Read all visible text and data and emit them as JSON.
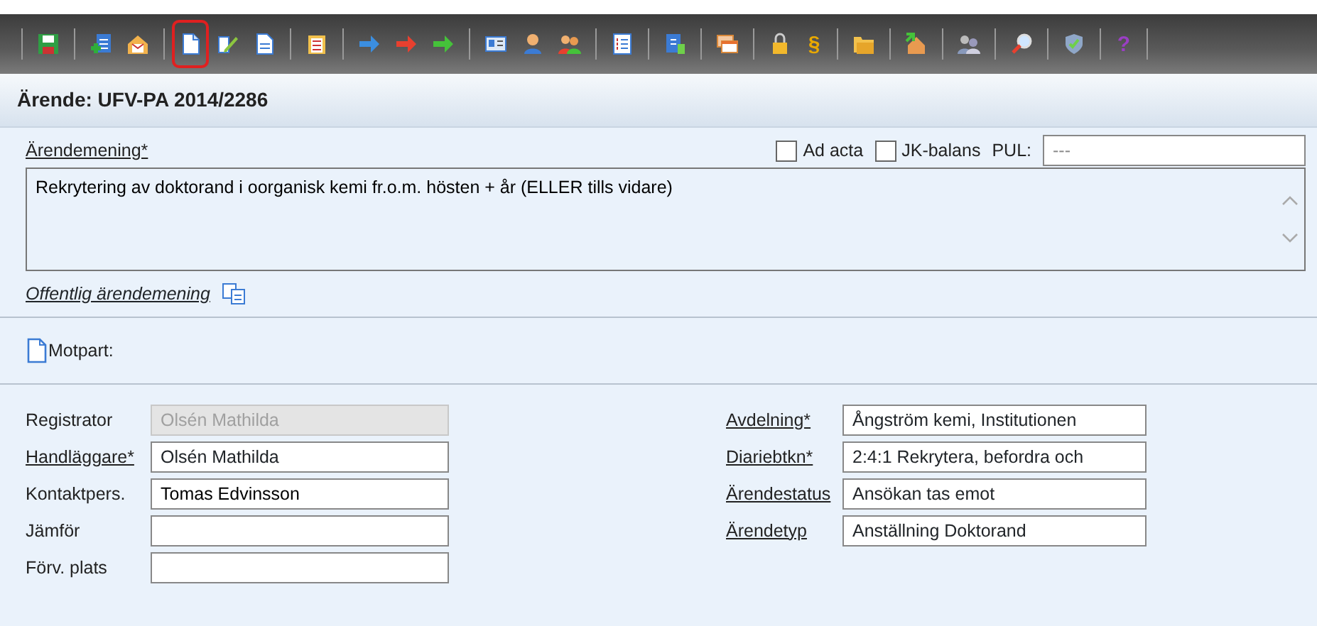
{
  "toolbar": {
    "groups": [
      {
        "buttons": [
          {
            "kind": "icon",
            "selected": false
          }
        ]
      },
      {
        "buttons": [
          {
            "kind": "icon",
            "selected": false
          },
          {
            "kind": "icon",
            "selected": false
          }
        ]
      },
      {
        "buttons": [
          {
            "kind": "icon",
            "selected": true
          },
          {
            "kind": "icon",
            "selected": false
          },
          {
            "kind": "icon",
            "selected": false
          }
        ]
      },
      {
        "buttons": [
          {
            "kind": "icon",
            "selected": false
          }
        ]
      },
      {
        "buttons": [
          {
            "kind": "icon",
            "selected": false
          },
          {
            "kind": "icon",
            "selected": false
          },
          {
            "kind": "icon",
            "selected": false
          }
        ]
      },
      {
        "buttons": [
          {
            "kind": "icon",
            "selected": false
          },
          {
            "kind": "icon",
            "selected": false
          },
          {
            "kind": "icon",
            "selected": false
          }
        ]
      },
      {
        "buttons": [
          {
            "kind": "icon",
            "selected": false
          }
        ]
      },
      {
        "buttons": [
          {
            "kind": "icon",
            "selected": false
          }
        ]
      },
      {
        "buttons": [
          {
            "kind": "icon",
            "selected": false
          }
        ]
      },
      {
        "buttons": [
          {
            "kind": "icon",
            "selected": false
          },
          {
            "kind": "glyph",
            "glyph": "§",
            "selected": false
          }
        ]
      },
      {
        "buttons": [
          {
            "kind": "icon",
            "selected": false
          }
        ]
      },
      {
        "buttons": [
          {
            "kind": "icon",
            "selected": false
          }
        ]
      },
      {
        "buttons": [
          {
            "kind": "icon",
            "selected": false
          }
        ]
      },
      {
        "buttons": [
          {
            "kind": "icon",
            "selected": false
          }
        ]
      },
      {
        "buttons": [
          {
            "kind": "icon",
            "selected": false
          }
        ]
      },
      {
        "buttons": [
          {
            "kind": "glyph",
            "glyph": "?",
            "selected": false
          }
        ]
      }
    ]
  },
  "header": {
    "title": "Ärende: UFV-PA 2014/2286"
  },
  "description": {
    "label": "Ärendemening*",
    "linked": true,
    "value": "Rekrytering av doktorand i oorganisk kemi fr.o.m. hösten + år (ELLER tills vidare)",
    "checkboxes": [
      {
        "label": "Ad acta",
        "checked": false
      },
      {
        "label": "JK-balans",
        "checked": false
      }
    ],
    "pul": {
      "label": "PUL:",
      "value": "---"
    },
    "public_link": "Offentlig ärendemening"
  },
  "counterpart": {
    "label": "Motpart:"
  },
  "left_fields": [
    {
      "label": "Registrator",
      "linked": false,
      "kind": "readonly",
      "value": "Olsén Mathilda"
    },
    {
      "label": "Handläggare*",
      "linked": true,
      "kind": "select",
      "value": "Olsén Mathilda"
    },
    {
      "label": "Kontaktpers.",
      "linked": false,
      "kind": "text",
      "value": "Tomas Edvinsson"
    },
    {
      "label": "Jämför",
      "linked": false,
      "kind": "text"
    },
    {
      "label": "Förv. plats",
      "linked": false,
      "kind": "text"
    }
  ],
  "right_fields": [
    {
      "label": "Avdelning*",
      "linked": true,
      "kind": "select",
      "value": "Ångström kemi, Institutionen"
    },
    {
      "label": "Diariebtkn*",
      "linked": true,
      "kind": "select",
      "value": "2:4:1 Rekrytera, befordra och"
    },
    {
      "label": "Ärendestatus",
      "linked": true,
      "kind": "select",
      "value": "Ansökan tas emot"
    },
    {
      "label": "Ärendetyp",
      "linked": true,
      "kind": "select",
      "value": "Anställning Doktorand"
    }
  ]
}
